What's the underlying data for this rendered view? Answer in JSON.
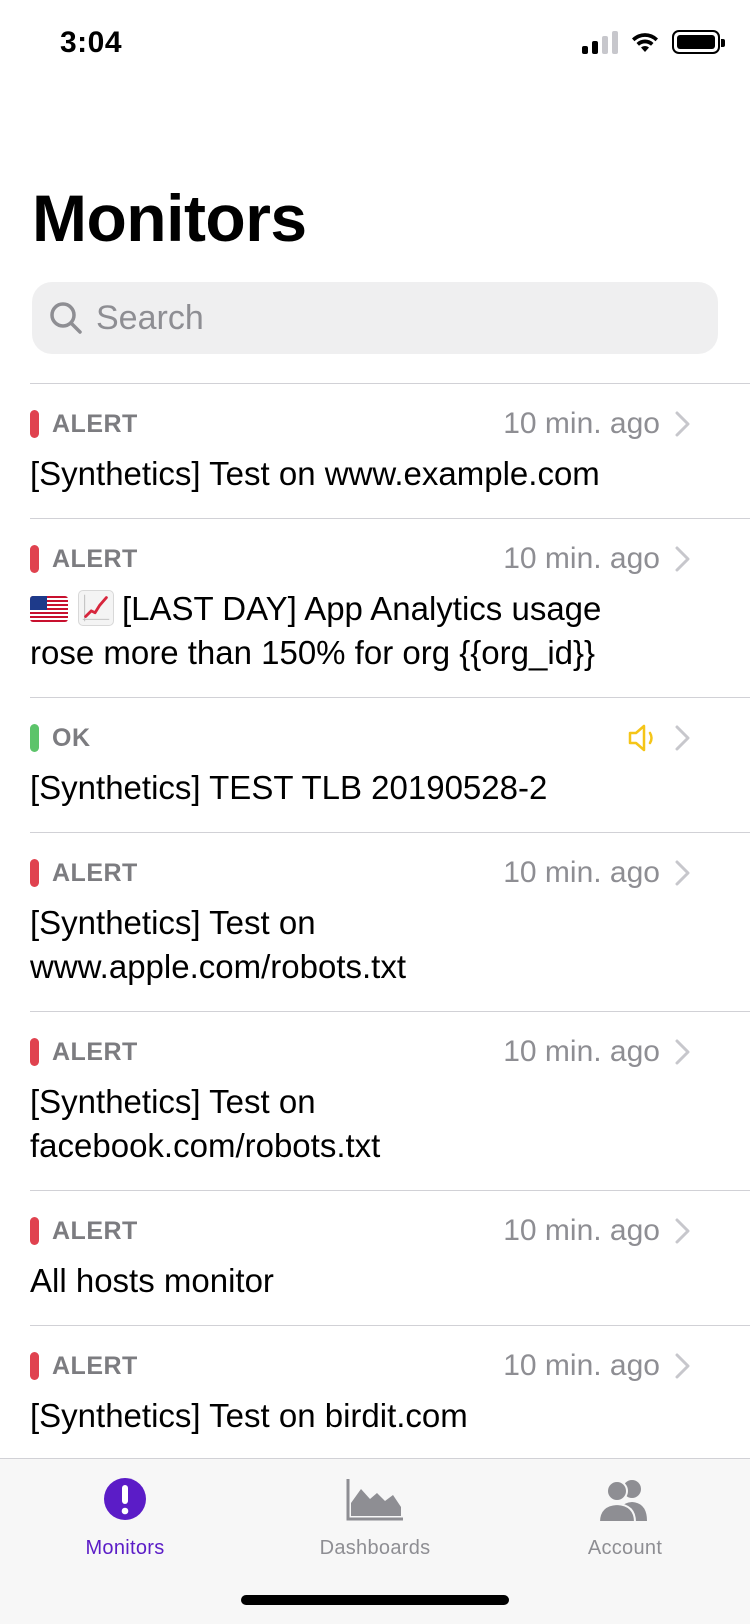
{
  "status_bar": {
    "time": "3:04"
  },
  "page_title": "Monitors",
  "search": {
    "placeholder": "Search",
    "value": ""
  },
  "colors": {
    "alert": "#e0424f",
    "ok": "#5cc46a",
    "accent": "#5b1cc7",
    "muted_icon": "#8e8e93",
    "speaker": "#f5c518"
  },
  "monitors": [
    {
      "status": "ALERT",
      "time": "10 min. ago",
      "title": "[Synthetics] Test on www.example.com"
    },
    {
      "status": "ALERT",
      "time": "10 min. ago",
      "title": "[LAST DAY] App Analytics usage rose more than 150% for org {{org_id}}",
      "icons": [
        "us-flag-emoji",
        "chart-increasing-emoji"
      ]
    },
    {
      "status": "OK",
      "time": "",
      "title": "[Synthetics] TEST TLB 20190528-2",
      "icons": [
        "speaker-icon"
      ]
    },
    {
      "status": "ALERT",
      "time": "10 min. ago",
      "title": "[Synthetics] Test on www.apple.com/robots.txt"
    },
    {
      "status": "ALERT",
      "time": "10 min. ago",
      "title": "[Synthetics] Test on facebook.com/robots.txt"
    },
    {
      "status": "ALERT",
      "time": "10 min. ago",
      "title": "All hosts monitor"
    },
    {
      "status": "ALERT",
      "time": "10 min. ago",
      "title": "[Synthetics] Test on birdit.com"
    }
  ],
  "tab_bar": {
    "tabs": [
      {
        "label": "Monitors",
        "icon": "exclamation-circle-icon",
        "active": true
      },
      {
        "label": "Dashboards",
        "icon": "area-chart-icon",
        "active": false
      },
      {
        "label": "Account",
        "icon": "people-icon",
        "active": false
      }
    ]
  }
}
